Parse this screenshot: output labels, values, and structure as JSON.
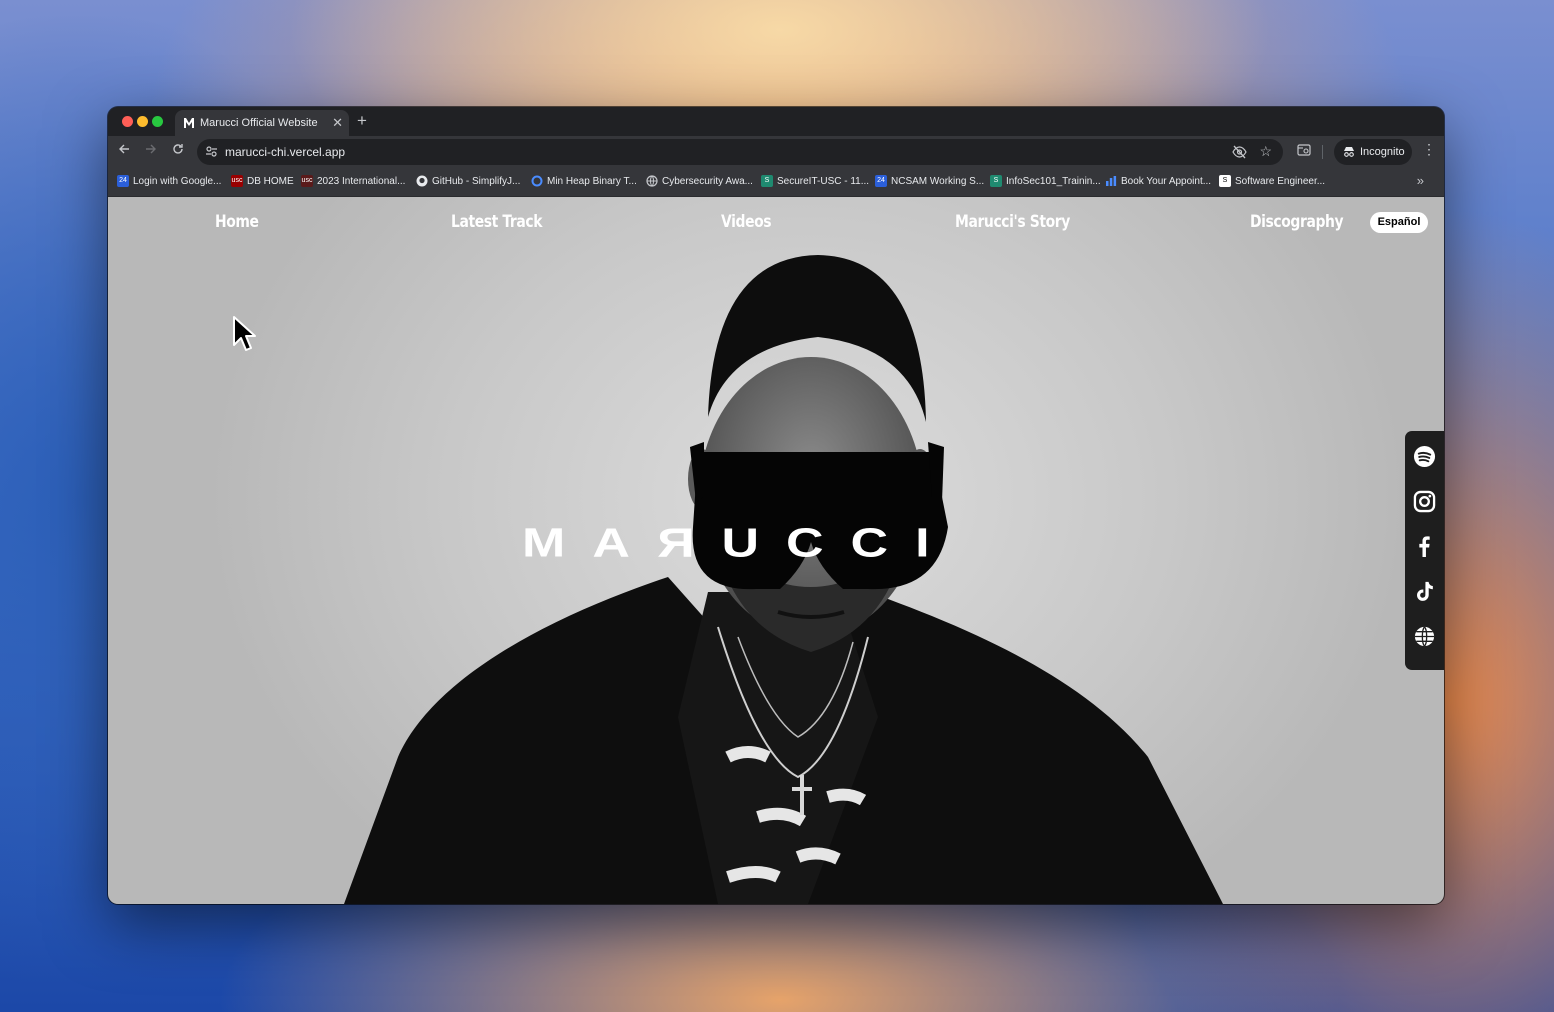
{
  "browser": {
    "tab_title": "Marucci Official Website",
    "new_tab_symbol": "+",
    "close_symbol": "✕",
    "url": "marucci-chi.vercel.app",
    "incognito_label": "Incognito",
    "bookmarks": [
      {
        "label": "Login with Google...",
        "icon": "gs-icon"
      },
      {
        "label": "DB HOME",
        "icon": "usc-icon"
      },
      {
        "label": "2023 International...",
        "icon": "usc-icon"
      },
      {
        "label": "GitHub - SimplifyJ...",
        "icon": "github-icon"
      },
      {
        "label": "Min Heap Binary T...",
        "icon": "loop-icon"
      },
      {
        "label": "Cybersecurity Awa...",
        "icon": "globe-icon"
      },
      {
        "label": "SecureIT-USC - 11...",
        "icon": "secure-icon"
      },
      {
        "label": "NCSAM Working S...",
        "icon": "gs-icon"
      },
      {
        "label": "InfoSec101_Trainin...",
        "icon": "secure-icon"
      },
      {
        "label": "Book Your Appoint...",
        "icon": "chart-icon"
      },
      {
        "label": "Software Engineer...",
        "icon": "doc-icon"
      }
    ],
    "bookmarks_more": "»"
  },
  "site": {
    "nav": [
      "Home",
      "Latest Track",
      "Videos",
      "Marucci's Story",
      "Discography"
    ],
    "language_button": "Español",
    "brand_pre": "MA",
    "brand_reversed": "R",
    "brand_post": "UCCI",
    "social_icons": [
      "spotify-icon",
      "instagram-icon",
      "facebook-icon",
      "tiktok-icon",
      "website-globe-icon"
    ]
  },
  "colors": {
    "browser_bg": "#202124",
    "toolbar_bg": "#35363a",
    "page_bg": "#d0d0d0",
    "social_bar": "#1e1e1e"
  }
}
